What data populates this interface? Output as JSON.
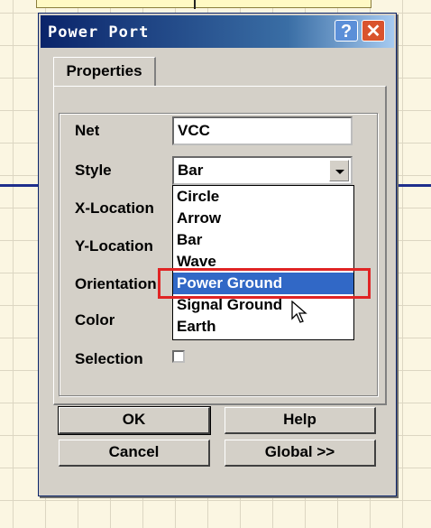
{
  "dialog": {
    "title": "Power Port",
    "tab": "Properties",
    "fields": {
      "net_label": "Net",
      "net_value": "VCC",
      "style_label": "Style",
      "style_value": "Bar",
      "xloc_label": "X-Location",
      "yloc_label": "Y-Location",
      "orient_label": "Orientation",
      "color_label": "Color",
      "selection_label": "Selection"
    },
    "style_options": [
      "Circle",
      "Arrow",
      "Bar",
      "Wave",
      "Power Ground",
      "Signal Ground",
      "Earth"
    ],
    "selected_option": "Power Ground",
    "buttons": {
      "ok": "OK",
      "help": "Help",
      "cancel": "Cancel",
      "global": "Global >>"
    },
    "colors": {
      "title_bar": "#0a246a",
      "highlight": "#3168c6",
      "annotation": "#e02424"
    }
  }
}
